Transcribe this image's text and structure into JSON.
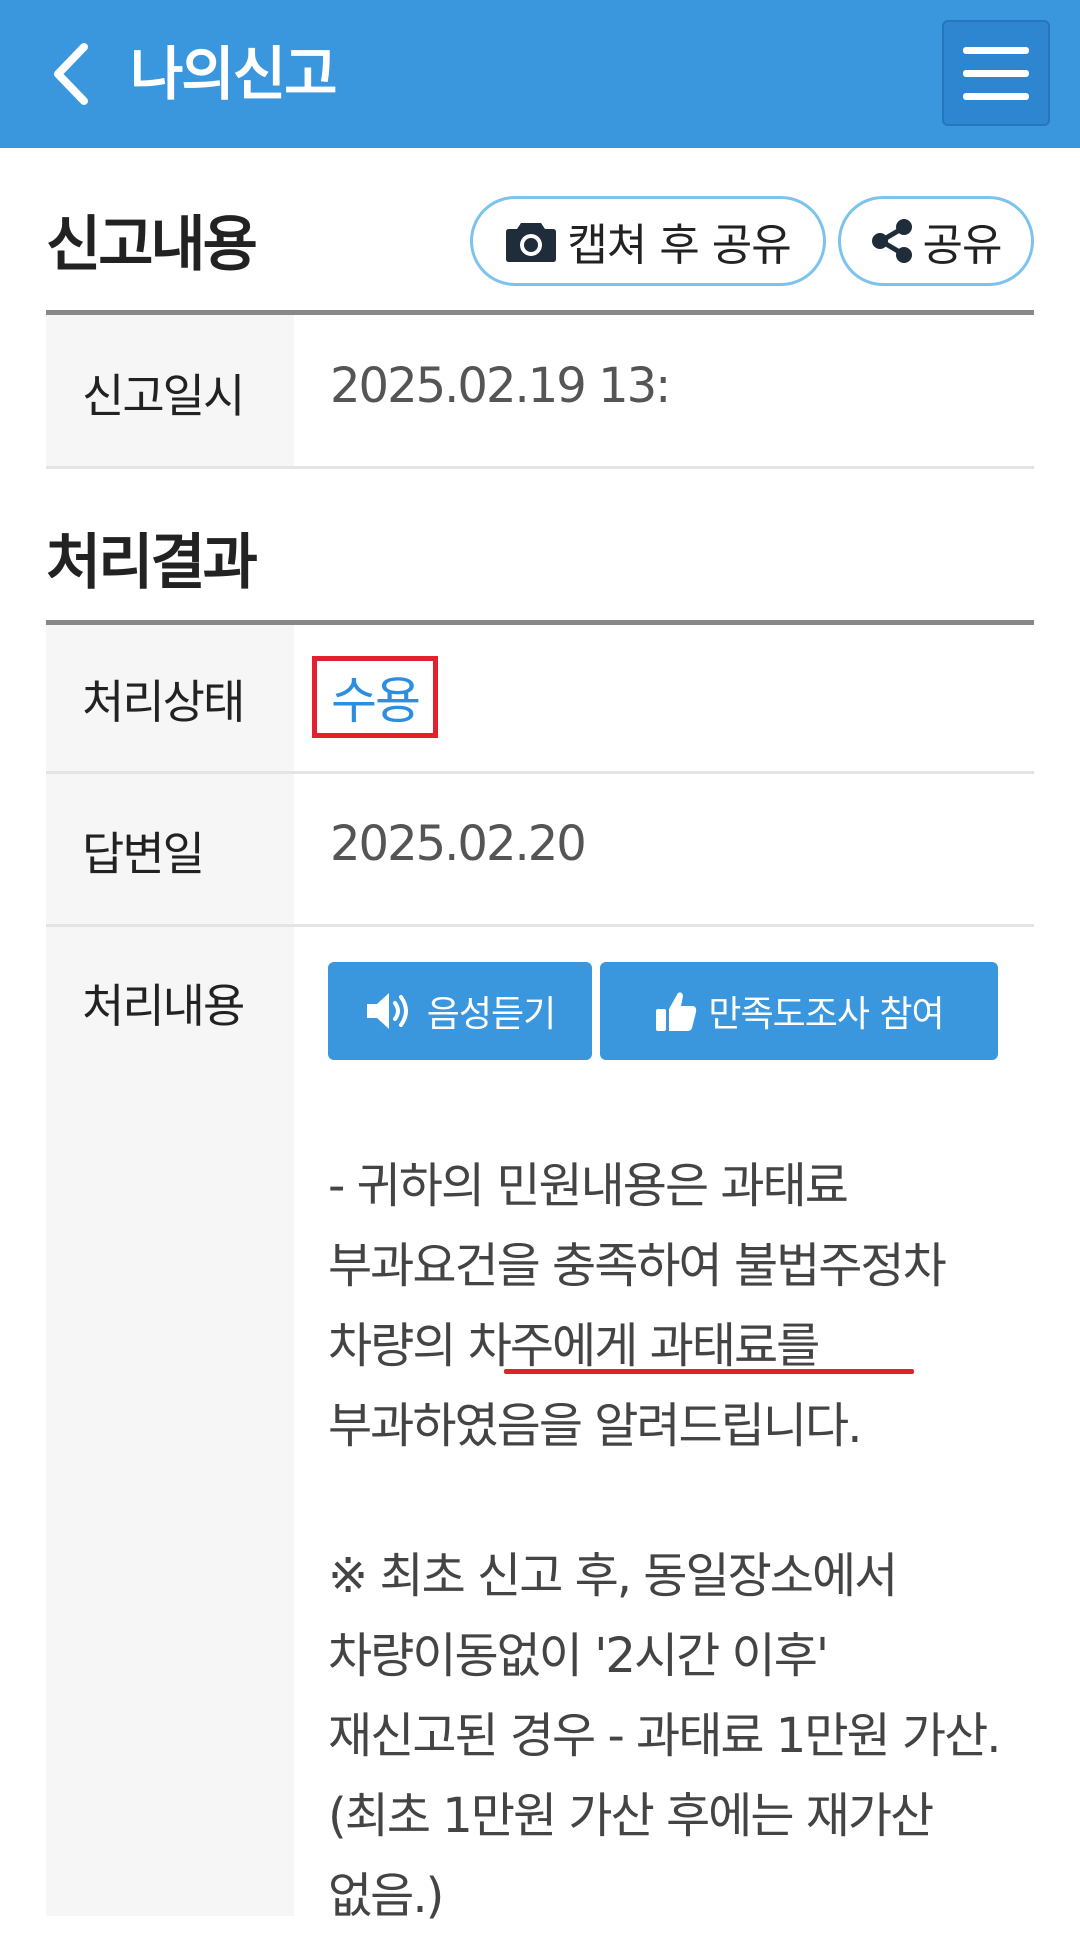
{
  "header": {
    "title": "나의신고",
    "bg_color": "#3a97de"
  },
  "report_section": {
    "title": "신고내용",
    "capture_share_label": "캡쳐 후 공유",
    "share_label": "공유",
    "rows": [
      {
        "label": "신고일시",
        "value": "2025.02.19 13:"
      }
    ]
  },
  "result_section": {
    "title": "처리결과",
    "status_label": "처리상태",
    "status_value": "수용",
    "answer_date_label": "답변일",
    "answer_date_value": "2025.02.20",
    "content_label": "처리내용",
    "listen_button": "음성듣기",
    "survey_button": "만족도조사 참여",
    "paragraph1_before": "- 귀하의 민원내용은 과태료 부과요건을 충족하여 불법주정차 차량의 차주에게 ",
    "paragraph1_highlight": "과태료를 부과하였음",
    "paragraph1_after": "을 알려드립니다.",
    "paragraph2": "※ 최초 신고 후, 동일장소에서 차량이동없이 '2시간 이후' 재신고된 경우 - 과태료 1만원 가산. (최초 1만원 가산 후에는 재가산 없음.)"
  },
  "colors": {
    "accent": "#3a97de",
    "highlight_red": "#e5202e",
    "status_blue": "#2b8ee0"
  }
}
